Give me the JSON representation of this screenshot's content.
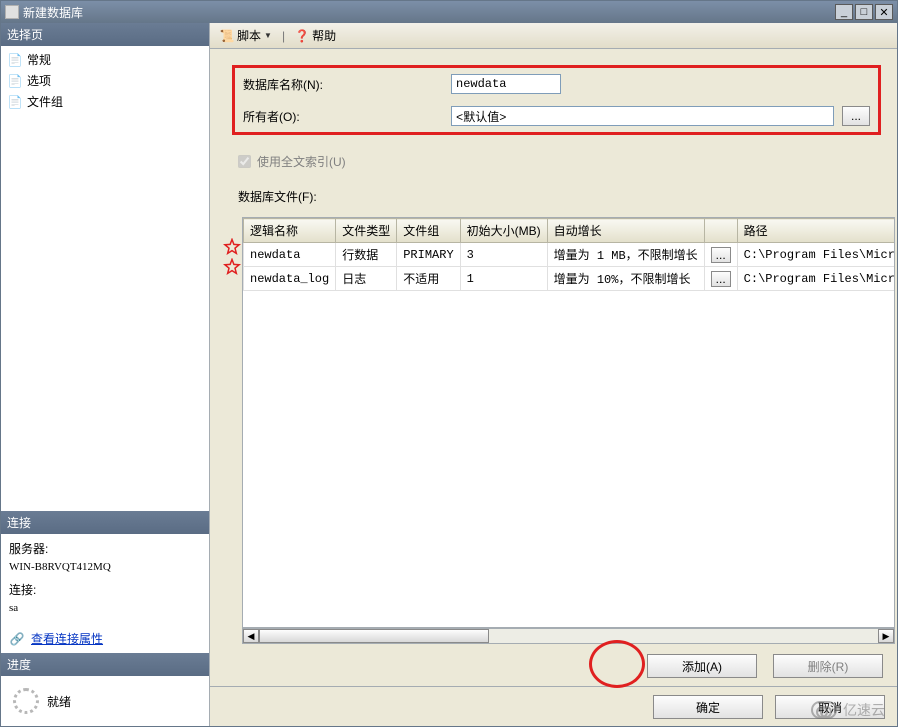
{
  "window": {
    "title": "新建数据库"
  },
  "sidebar": {
    "select_page_header": "选择页",
    "pages": [
      {
        "label": "常规"
      },
      {
        "label": "选项"
      },
      {
        "label": "文件组"
      }
    ],
    "connection_header": "连接",
    "server_label": "服务器:",
    "server_value": "WIN-B8RVQT412MQ",
    "conn_label": "连接:",
    "conn_value": "sa",
    "view_conn_props": "查看连接属性",
    "progress_header": "进度",
    "ready_label": "就绪"
  },
  "toolbar": {
    "script_label": "脚本",
    "help_label": "帮助"
  },
  "form": {
    "db_name_label": "数据库名称(N):",
    "db_name_value": "newdata",
    "owner_label": "所有者(O):",
    "owner_value": "<默认值>",
    "fulltext_label": "使用全文索引(U)",
    "files_label": "数据库文件(F):"
  },
  "table": {
    "headers": {
      "logical_name": "逻辑名称",
      "file_type": "文件类型",
      "filegroup": "文件组",
      "initial_size": "初始大小(MB)",
      "autogrowth": "自动增长",
      "path": "路径"
    },
    "rows": [
      {
        "logical_name": "newdata",
        "file_type": "行数据",
        "filegroup": "PRIMARY",
        "initial_size": "3",
        "autogrowth": "增量为 1 MB，不限制增长",
        "path": "C:\\Program Files\\Micr"
      },
      {
        "logical_name": "newdata_log",
        "file_type": "日志",
        "filegroup": "不适用",
        "initial_size": "1",
        "autogrowth": "增量为 10%，不限制增长",
        "path": "C:\\Program Files\\Micr"
      }
    ]
  },
  "buttons": {
    "add": "添加(A)",
    "remove": "删除(R)",
    "ok": "确定",
    "cancel": "取消",
    "browse": "..."
  },
  "watermark": "亿速云"
}
